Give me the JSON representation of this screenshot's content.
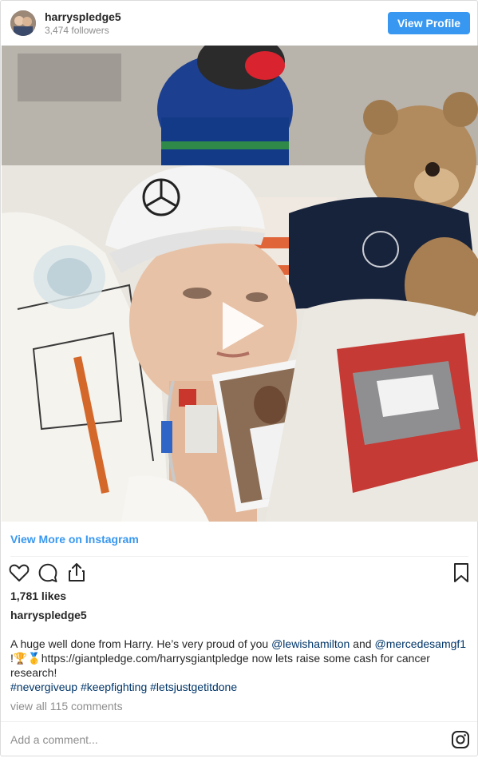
{
  "header": {
    "username": "harryspledge5",
    "followers": "3,474 followers",
    "view_profile_label": "View Profile"
  },
  "post": {
    "view_more_label": "View More on Instagram",
    "likes": "1,781 likes",
    "caption_username": "harryspledge5",
    "caption_parts": {
      "intro": "A huge well done from Harry. He’s very proud of you ",
      "mention1": "@lewishamilton",
      "and": " and ",
      "mention2": "@mercedesamgf1",
      "after": " !🏆🥇https://giantpledge.com/harrysgiantpledge now lets raise some cash for cancer research!",
      "hashtag1": "#nevergiveup",
      "hashtag2": "#keepfighting",
      "hashtag3": "#letsjustgetitdone"
    },
    "view_comments": "view all 115 comments",
    "comment_placeholder": "Add a comment..."
  },
  "icons": {
    "like": "heart-icon",
    "comment": "comment-icon",
    "share": "share-icon",
    "save": "bookmark-icon",
    "brand": "instagram-logo-icon",
    "play": "play-icon"
  },
  "colors": {
    "accent": "#3897f0",
    "link": "#003569",
    "muted": "#8e8e8e",
    "text": "#262626"
  }
}
